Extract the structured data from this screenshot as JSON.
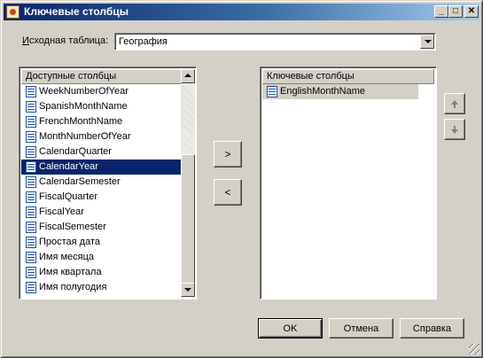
{
  "window": {
    "title": "Ключевые столбцы",
    "minimize_glyph": "_",
    "maximize_glyph": "□",
    "close_glyph": "✕"
  },
  "source": {
    "label_underlined": "И",
    "label_rest": "сходная таблица:",
    "value": "География"
  },
  "available": {
    "header": "Доступные столбцы",
    "items": [
      "WeekNumberOfYear",
      "SpanishMonthName",
      "FrenchMonthName",
      "MonthNumberOfYear",
      "CalendarQuarter",
      "CalendarYear",
      "CalendarSemester",
      "FiscalQuarter",
      "FiscalYear",
      "FiscalSemester",
      "Простая дата",
      "Имя месяца",
      "Имя квартала",
      "Имя полугодия"
    ],
    "selected_item": "CalendarYear"
  },
  "key": {
    "header": "Ключевые столбцы",
    "items": [
      "EnglishMonthName"
    ]
  },
  "buttons": {
    "move_right": ">",
    "move_left": "<",
    "ok": "OK",
    "cancel": "Отмена",
    "help": "Справка"
  },
  "colors": {
    "dialog_face": "#d4d0c8",
    "title_active": "#0a246a",
    "selection": "#0a246a"
  }
}
